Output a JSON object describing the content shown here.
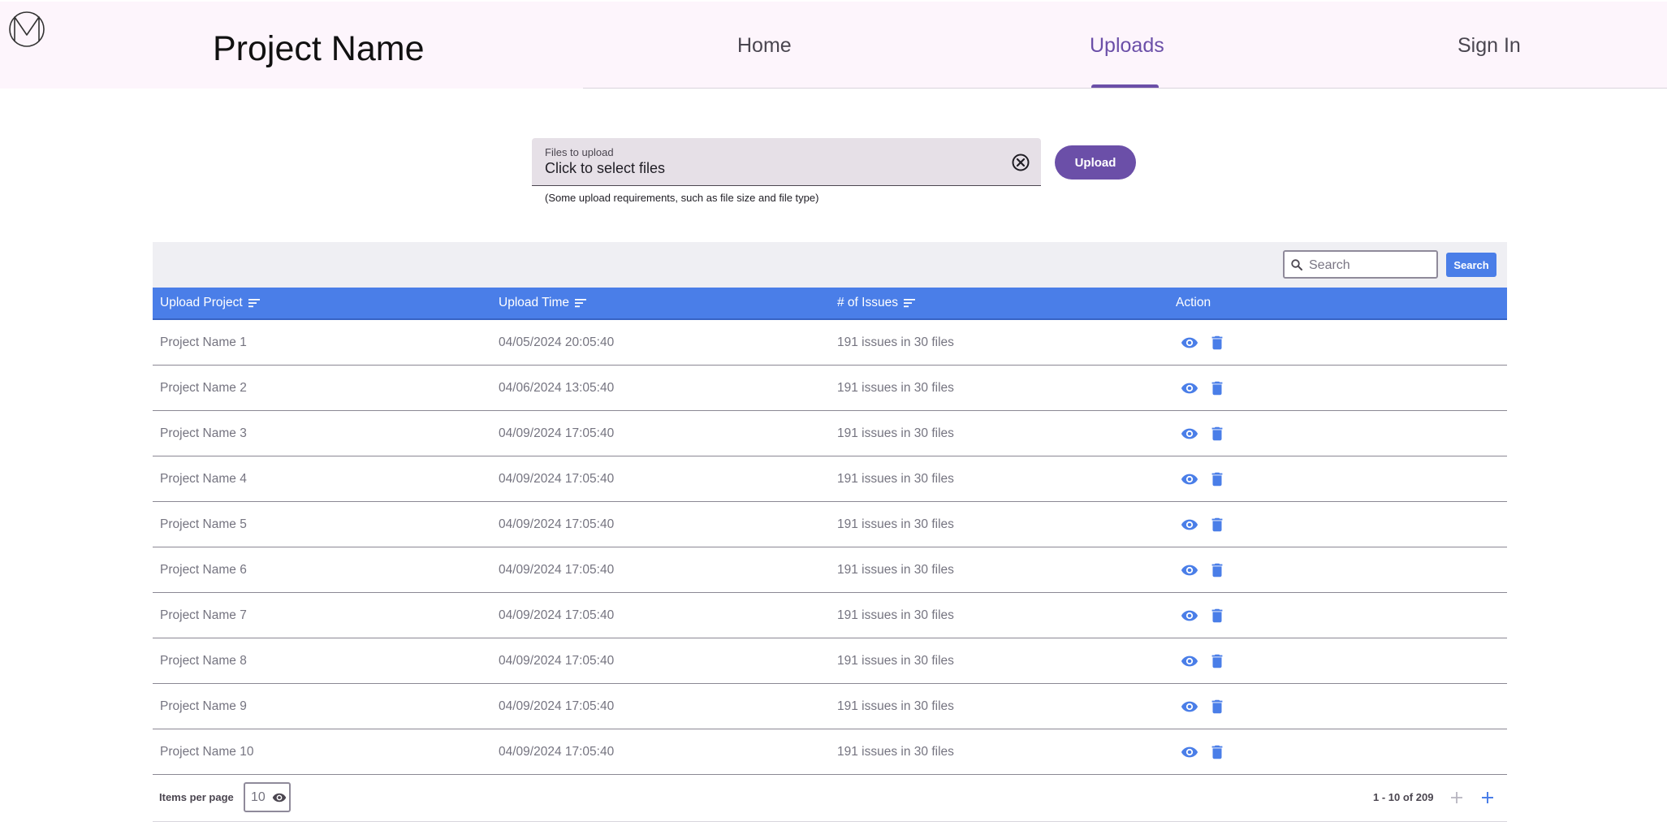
{
  "header": {
    "title": "Project Name",
    "nav": {
      "home": "Home",
      "uploads": "Uploads",
      "sign_in": "Sign In"
    },
    "active_tab": "Uploads"
  },
  "upload": {
    "field_label": "Files to upload",
    "field_value": "Click to select files",
    "hint": "(Some upload requirements, such as file size and file type)",
    "button_label": "Upload"
  },
  "table": {
    "search_placeholder": "Search",
    "search_button": "Search",
    "columns": [
      "Upload Project",
      "Upload Time",
      "# of Issues",
      "Action"
    ],
    "rows": [
      {
        "project": "Project Name 1",
        "time": "04/05/2024 20:05:40",
        "issues": "191 issues in 30 files"
      },
      {
        "project": "Project Name 2",
        "time": "04/06/2024 13:05:40",
        "issues": "191 issues in 30 files"
      },
      {
        "project": "Project Name 3",
        "time": "04/09/2024 17:05:40",
        "issues": "191 issues in 30 files"
      },
      {
        "project": "Project Name 4",
        "time": "04/09/2024 17:05:40",
        "issues": "191 issues in 30 files"
      },
      {
        "project": "Project Name 5",
        "time": "04/09/2024 17:05:40",
        "issues": "191 issues in 30 files"
      },
      {
        "project": "Project Name 6",
        "time": "04/09/2024 17:05:40",
        "issues": "191 issues in 30 files"
      },
      {
        "project": "Project Name 7",
        "time": "04/09/2024 17:05:40",
        "issues": "191 issues in 30 files"
      },
      {
        "project": "Project Name 8",
        "time": "04/09/2024 17:05:40",
        "issues": "191 issues in 30 files"
      },
      {
        "project": "Project Name 9",
        "time": "04/09/2024 17:05:40",
        "issues": "191 issues in 30 files"
      },
      {
        "project": "Project Name 10",
        "time": "04/09/2024 17:05:40",
        "issues": "191 issues in 30 files"
      }
    ],
    "row_actions": [
      "eye-icon",
      "trash-icon"
    ],
    "pagination": {
      "items_per_page_label": "Items per page",
      "items_per_page": "10",
      "range": "1 - 10 of 209"
    }
  },
  "colors": {
    "accent_purple": "#6b4fa8",
    "table_blue": "#4a7ee8",
    "header_bg": "#fdf5fc"
  }
}
